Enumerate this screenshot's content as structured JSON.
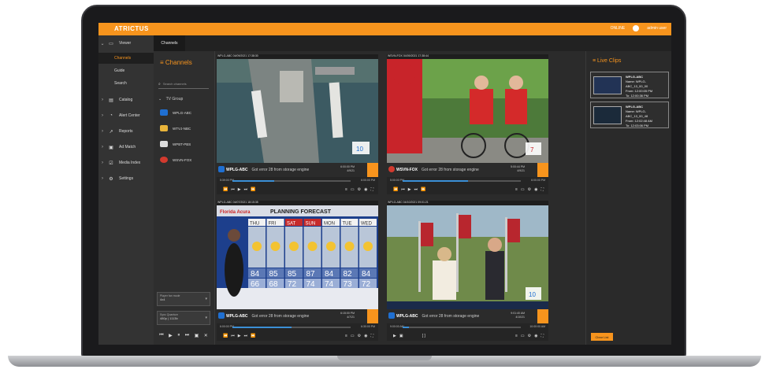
{
  "app": {
    "logo": "ATRICTUS",
    "user_status": "ONLINE",
    "user_name": "admin user"
  },
  "nav": {
    "viewer_label": "Viewer",
    "sub": [
      {
        "label": "Channels",
        "active": true
      },
      {
        "label": "Guide",
        "active": false
      },
      {
        "label": "Search",
        "active": false
      }
    ],
    "items": [
      {
        "label": "Catalog",
        "icon": "catalog-icon"
      },
      {
        "label": "Alert Center",
        "icon": "bell-icon"
      },
      {
        "label": "Reports",
        "icon": "chart-icon"
      },
      {
        "label": "Ad Match",
        "icon": "ad-icon"
      },
      {
        "label": "Media Index",
        "icon": "media-index-icon"
      },
      {
        "label": "Settings",
        "icon": "gear-icon"
      }
    ]
  },
  "tabs": [
    {
      "label": "Channels"
    }
  ],
  "channels_panel": {
    "title": "Channels",
    "search_placeholder": "Search channels",
    "group_label": "TV Group",
    "channels": [
      {
        "name": "WPLG-ABC",
        "color": "#1f6fd1"
      },
      {
        "name": "WTVJ-NBC",
        "color": "#e9b43a"
      },
      {
        "name": "WPBT-PBS",
        "color": "#dddddd"
      },
      {
        "name": "WSVN-FOX",
        "color": "#d23a2e"
      }
    ],
    "select1": {
      "label": "Player fan mode",
      "value": "4x4"
    },
    "select2": {
      "label": "Sync Quantum",
      "value": "480p | 1113b"
    }
  },
  "tiles": [
    {
      "timestamp": "WPLG-ABC 04/09/2021 17:38:30",
      "channel": "WPLG-ABC",
      "error": "Got error 28 from storage engine",
      "time_top": "6:00:00 PM",
      "time_bottom": "4/9/21",
      "tl_start": "5:39:00 PM",
      "tl_end": "6:00:00 PM",
      "progress": 0.35,
      "logo_color": "#1f6fd1"
    },
    {
      "timestamp": "WSVN-FOX 04/09/2021 17:38:44",
      "channel": "WSVN-FOX",
      "error": "Got error 28 from storage engine",
      "time_top": "5:00:44 PM",
      "time_bottom": "4/9/21",
      "tl_start": "5:00:00 PM",
      "tl_end": "6:00:00 PM",
      "progress": 0.55,
      "logo_color": "#d23a2e"
    },
    {
      "timestamp": "WPLG-ABC 04/07/2021 18:15:35",
      "channel": "WPLG-ABC",
      "error": "Got error 28 from storage engine",
      "time_top": "6:15:00 PM",
      "time_bottom": "4/7/21",
      "tl_start": "6:00:00 PM",
      "tl_end": "6:30:00 PM",
      "progress": 0.5,
      "logo_color": "#1f6fd1"
    },
    {
      "timestamp": "WPLG-ABC 04/10/2021 09:01:21",
      "channel": "WPLG-ABC",
      "error": "Got error 28 from storage engine",
      "time_top": "9:01:40 AM",
      "time_bottom": "4/10/21",
      "tl_start": "9:00:00 AM",
      "tl_end": "10:00:00 AM",
      "progress": 0.05,
      "logo_color": "#1f6fd1"
    }
  ],
  "forecast": {
    "sponsor": "Florida Acura",
    "title": "PLANNING FORECAST",
    "days": [
      "THU",
      "FRI",
      "SAT",
      "SUN",
      "MON",
      "TUE",
      "WED"
    ],
    "highs": [
      "84",
      "85",
      "85",
      "87",
      "84",
      "82",
      "84"
    ],
    "lows": [
      "66",
      "68",
      "72",
      "74",
      "74",
      "73",
      "72"
    ]
  },
  "live_clips": {
    "title": "Live Clips",
    "clips": [
      {
        "channel": "WPLG-ABC",
        "name": "Name: WPLG-ABC_13_00_00",
        "from": "From: 12:00:05 PM",
        "to": "To: 12:00:36 PM"
      },
      {
        "channel": "WPLG-ABC",
        "name": "Name: WPLG-ABC_13_00_48",
        "from": "From: 12:02:48 AM",
        "to": "To: 12:03:06 PM"
      }
    ],
    "clear_label": "Clear List"
  },
  "colors": {
    "accent": "#f7941d",
    "bg": "#2b2b2b",
    "progress": "#3b8fd6"
  }
}
